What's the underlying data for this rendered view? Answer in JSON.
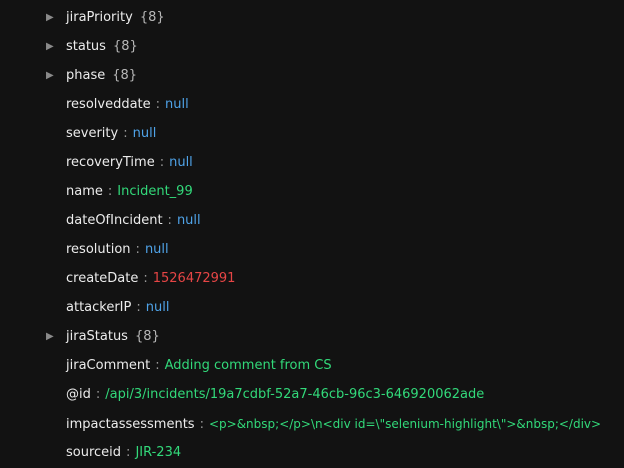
{
  "rows": [
    {
      "key": "jiraPriority",
      "count": "{8}",
      "expandable": true
    },
    {
      "key": "status",
      "count": "{8}",
      "expandable": true
    },
    {
      "key": "phase",
      "count": "{8}",
      "expandable": true
    },
    {
      "key": "resolveddate",
      "value": "null",
      "type": "null"
    },
    {
      "key": "severity",
      "value": "null",
      "type": "null"
    },
    {
      "key": "recoveryTime",
      "value": "null",
      "type": "null"
    },
    {
      "key": "name",
      "value": "Incident_99",
      "type": "string"
    },
    {
      "key": "dateOfIncident",
      "value": "null",
      "type": "null"
    },
    {
      "key": "resolution",
      "value": "null",
      "type": "null"
    },
    {
      "key": "createDate",
      "value": "1526472991",
      "type": "number"
    },
    {
      "key": "attackerIP",
      "value": "null",
      "type": "null"
    },
    {
      "key": "jiraStatus",
      "count": "{8}",
      "expandable": true
    },
    {
      "key": "jiraComment",
      "value": "Adding comment from CS",
      "type": "string"
    },
    {
      "key": "@id",
      "value": "/api/3/incidents/19a7cdbf-52a7-46cb-96c3-646920062ade",
      "type": "string"
    },
    {
      "key": "impactassessments",
      "value": "<p>&nbsp;</p>\\n<div id=\\\"selenium-highlight\\\">&nbsp;</div>",
      "type": "string"
    },
    {
      "key": "sourceid",
      "value": "JIR-234",
      "type": "string"
    }
  ],
  "colors": {
    "background": "#121212",
    "key": "#ececec",
    "null": "#4fa3e8",
    "string": "#32d97a",
    "number": "#e64545"
  },
  "icons": {
    "expand": "caret-right-icon"
  }
}
